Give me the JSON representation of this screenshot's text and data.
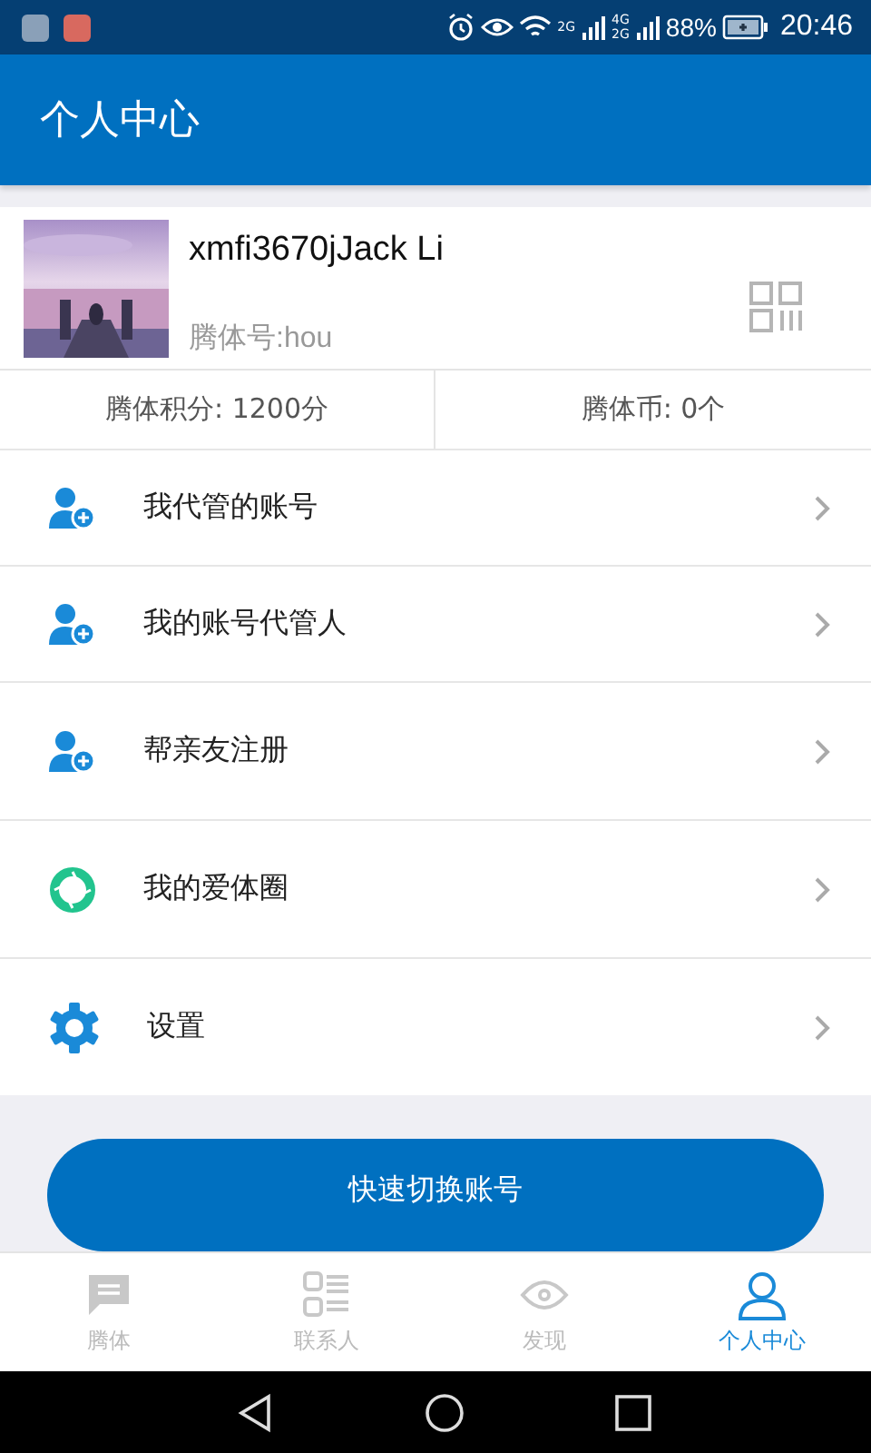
{
  "status_bar": {
    "network_labels": [
      "2G",
      "4G",
      "2G"
    ],
    "battery": "88%",
    "time": "20:46"
  },
  "header": {
    "title": "个人中心"
  },
  "profile": {
    "name": "xmfi3670jJack Li",
    "account_id": "腾体号:hou"
  },
  "stats": [
    "腾体积分: 1200分",
    "腾体币: 0个"
  ],
  "menu": [
    {
      "label": "我代管的账号",
      "kind": "person-add"
    },
    {
      "label": "我的账号代管人",
      "kind": "person-add"
    },
    {
      "label": "帮亲友注册",
      "kind": "person-add"
    },
    {
      "label": "我的爱体圈",
      "kind": "ring"
    },
    {
      "label": "设置",
      "kind": "gear"
    }
  ],
  "switch_button": "快速切换账号",
  "tabs": [
    {
      "label": "腾体",
      "kind": "chat",
      "selected": false
    },
    {
      "label": "联系人",
      "kind": "contacts",
      "selected": false
    },
    {
      "label": "发现",
      "kind": "eye",
      "selected": false
    },
    {
      "label": "个人中心",
      "kind": "person",
      "selected": true
    }
  ]
}
